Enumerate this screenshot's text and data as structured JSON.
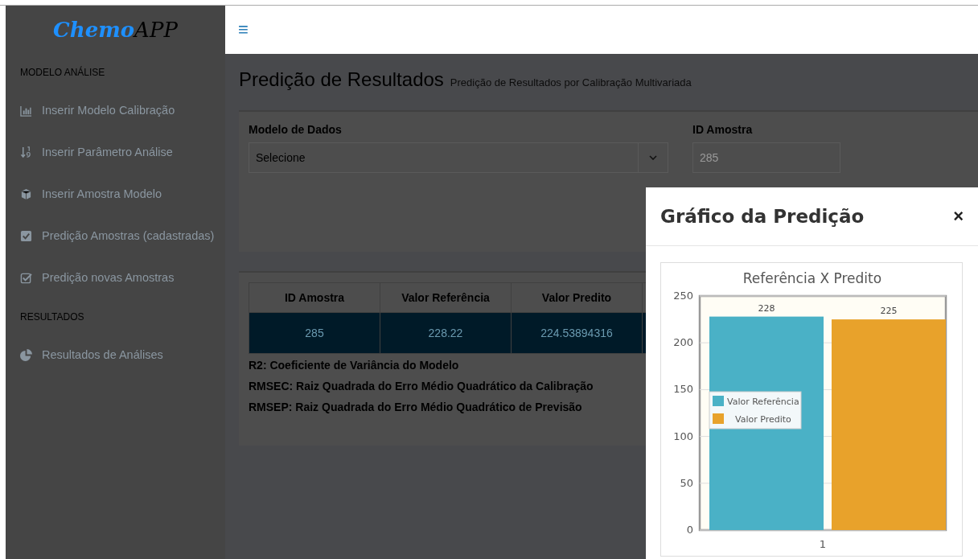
{
  "sidebar": {
    "logo": {
      "part_1": "Chemo",
      "part_2": "APP"
    },
    "sections": [
      {
        "title": "MODELO ANÁLISE",
        "items": [
          {
            "label": "Inserir Modelo Calibração"
          },
          {
            "label": "Inserir Parâmetro Análise"
          },
          {
            "label": "Inserir Amostra Modelo"
          },
          {
            "label": "Predição Amostras (cadastradas)"
          },
          {
            "label": "Predição novas Amostras"
          }
        ]
      },
      {
        "title": "RESULTADOS",
        "items": [
          {
            "label": "Resultados de Análises"
          }
        ]
      }
    ]
  },
  "header": {
    "menu_icon": "≡"
  },
  "page": {
    "title": "Predição de Resultados",
    "subtitle": "Predição de Resultados por Calibração Multivariada"
  },
  "form": {
    "model": {
      "label": "Modelo de Dados",
      "value": "Selecione"
    },
    "sample_id": {
      "label": "ID Amostra",
      "value": "285"
    }
  },
  "table": {
    "columns": [
      "ID Amostra",
      "Valor Referência",
      "Valor Predito"
    ],
    "rows": [
      {
        "cells": [
          "285",
          "228.22",
          "224.53894316"
        ],
        "selected": true
      }
    ]
  },
  "notes": [
    "R2: Coeficiente de Variância do Modelo",
    "RMSEC: Raiz Quadrada do Erro Médio Quadrático da Calibração",
    "RMSEP: Raiz Quadrada do Erro Médio Quadrático de Previsão"
  ],
  "modal": {
    "title": "Gráfico da Predição",
    "close": "×",
    "chart_data": {
      "type": "bar",
      "title": "Referência X Predito",
      "categories": [
        "1"
      ],
      "series": [
        {
          "name": "Valor Referência",
          "color": "#4ab1c6",
          "values": [
            228
          ]
        },
        {
          "name": "Valor Predito",
          "color": "#e8a22b",
          "values": [
            225
          ]
        }
      ],
      "ylim": [
        0,
        250
      ],
      "yticks": [
        0,
        50,
        100,
        150,
        200,
        250
      ],
      "data_labels": true,
      "grid": true,
      "legend": true
    }
  }
}
